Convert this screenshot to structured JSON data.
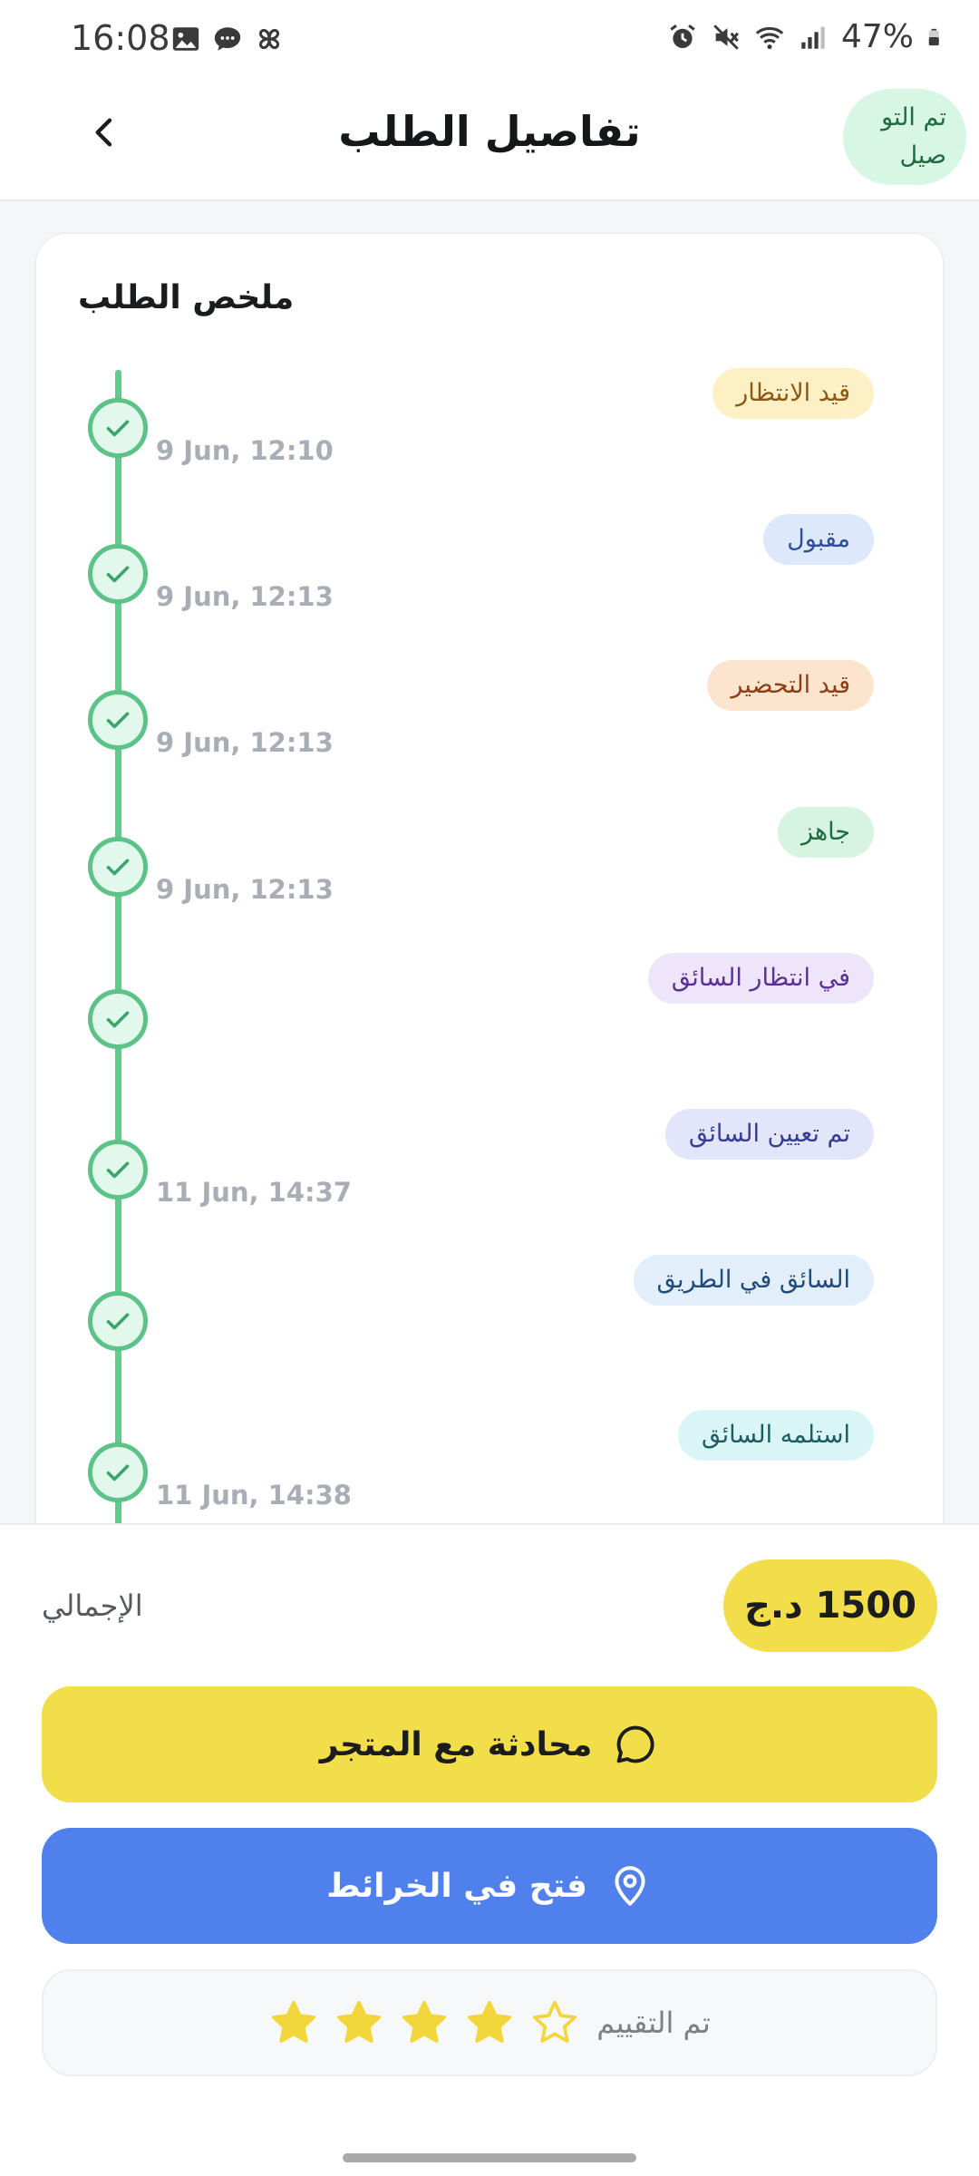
{
  "status_bar": {
    "time": "16:08",
    "battery": "47%",
    "left_icons": [
      "image-icon",
      "chat-bubble-icon",
      "pinwheel-icon"
    ],
    "right_icons": [
      "alarm-icon",
      "mute-icon",
      "wifi-icon",
      "signal-icon",
      "battery-icon"
    ]
  },
  "header": {
    "title": "تفاصيل الطلب",
    "status_pill": "تم التو صيل"
  },
  "summary": {
    "title": "ملخص الطلب",
    "steps": [
      {
        "label": "قيد الانتظار",
        "time": "9 Jun, 12:10",
        "badge_bg": "#fdf0c4",
        "badge_fg": "#8a5a14"
      },
      {
        "label": "مقبول",
        "time": "9 Jun, 12:13",
        "badge_bg": "#dde8fb",
        "badge_fg": "#2d4f9c"
      },
      {
        "label": "قيد التحضير",
        "time": "9 Jun, 12:13",
        "badge_bg": "#fde4cf",
        "badge_fg": "#8c3f12"
      },
      {
        "label": "جاهز",
        "time": "9 Jun, 12:13",
        "badge_bg": "#d7f4e2",
        "badge_fg": "#1f6b41"
      },
      {
        "label": "في انتظار السائق",
        "time": "",
        "badge_bg": "#efe5fb",
        "badge_fg": "#5c2f95"
      },
      {
        "label": "تم تعيين السائق",
        "time": "11 Jun, 14:37",
        "badge_bg": "#e3e5fa",
        "badge_fg": "#363d93"
      },
      {
        "label": "السائق في الطريق",
        "time": "",
        "badge_bg": "#e2effb",
        "badge_fg": "#1f4a7a"
      },
      {
        "label": "استلمه السائق",
        "time": "11 Jun, 14:38",
        "badge_bg": "#d9f5f6",
        "badge_fg": "#1c5d61"
      }
    ]
  },
  "total": {
    "label": "الإجمالي",
    "amount": "1500 د.ج"
  },
  "actions": {
    "chat_label": "محادثة مع المتجر",
    "maps_label": "فتح في الخرائط"
  },
  "rating": {
    "label": "تم التقييم",
    "value": 4,
    "max": 5
  },
  "colors": {
    "accent_yellow": "#f2dd4a",
    "accent_blue": "#4f80ec",
    "timeline_green": "#5cc288"
  }
}
